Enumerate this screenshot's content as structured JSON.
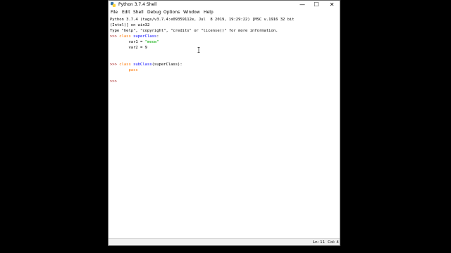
{
  "window": {
    "title": "Python 3.7.4 Shell",
    "controls": {
      "minimize": "—",
      "maximize": "☐",
      "close": "✕"
    }
  },
  "menu": [
    "File",
    "Edit",
    "Shell",
    "Debug",
    "Options",
    "Window",
    "Help"
  ],
  "shell": {
    "banner_lines": [
      "Python 3.7.4 (tags/v3.7.4:e09359112e, Jul  8 2019, 19:29:22) [MSC v.1916 32 bit",
      "(Intel)] on win32",
      "Type \"help\", \"copyright\", \"credits\" or \"license()\" for more information."
    ],
    "prompt": ">>> ",
    "block1": {
      "keyword": "class",
      "name": "superClass",
      "suffix": ":",
      "line2_indent": "        ",
      "line2_text": "var1 = ",
      "line2_string": "\"meow\"",
      "line3": "        var2 = 9"
    },
    "block2": {
      "keyword": "class",
      "name": "subClass",
      "suffix": "(superClass):",
      "line2_indent": "        ",
      "line2_keyword": "pass"
    }
  },
  "status": {
    "line": "Ln: 11",
    "col": "Col: 4"
  },
  "icons": [
    "python-app-icon",
    "minimize-icon",
    "maximize-icon",
    "close-icon",
    "text-cursor-icon"
  ]
}
